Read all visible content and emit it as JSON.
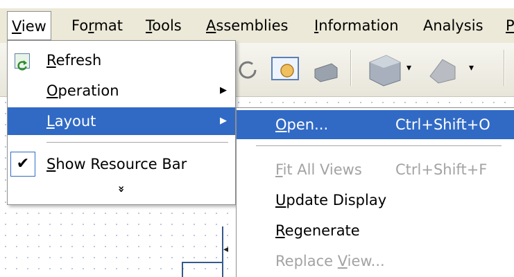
{
  "menubar": {
    "items": [
      {
        "label": "View",
        "mnemonic": "V"
      },
      {
        "label": "Format",
        "mnemonic": "r"
      },
      {
        "label": "Tools",
        "mnemonic": "T"
      },
      {
        "label": "Assemblies",
        "mnemonic": "A"
      },
      {
        "label": "Information",
        "mnemonic": "I"
      },
      {
        "label": "Analysis"
      },
      {
        "label": "P"
      }
    ]
  },
  "view_menu": {
    "items": [
      {
        "label": "Refresh",
        "icon": "refresh-icon"
      },
      {
        "label": "Operation",
        "has_submenu": true
      },
      {
        "label": "Layout",
        "has_submenu": true,
        "highlighted": true
      },
      {
        "label": "Show Resource Bar",
        "checked": true
      }
    ],
    "more_glyph": "»"
  },
  "layout_submenu": {
    "items": [
      {
        "label": "Open...",
        "shortcut": "Ctrl+Shift+O",
        "highlighted": true
      },
      {
        "label": "Fit All Views",
        "shortcut": "Ctrl+Shift+F",
        "disabled": true
      },
      {
        "label": "Update Display"
      },
      {
        "label": "Regenerate"
      },
      {
        "label": "Replace View...",
        "disabled": true
      }
    ]
  },
  "colors": {
    "highlight": "#316ac5",
    "menubar_bg": "#ece9d8",
    "disabled_text": "#a3a3a3"
  }
}
